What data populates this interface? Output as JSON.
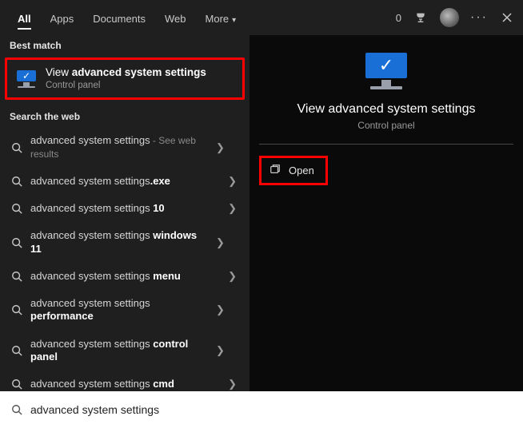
{
  "tabs": {
    "items": [
      "All",
      "Apps",
      "Documents",
      "Web",
      "More"
    ],
    "active_index": 0,
    "more_caret": "▾"
  },
  "header_right": {
    "points": "0",
    "trophy_icon": "trophy-icon",
    "avatar_icon": "avatar-icon",
    "more_label": "···",
    "close_label": "×"
  },
  "left": {
    "best_match_label": "Best match",
    "best_match": {
      "title_prefix": "View ",
      "title_bold": "advanced system settings",
      "subtitle": "Control panel",
      "icon": "monitor-check-icon"
    },
    "web_label": "Search the web",
    "web_items": [
      {
        "prefix": "advanced system settings",
        "bold": "",
        "suffix": " - See web results",
        "suffix_class": "sub",
        "multiline": true
      },
      {
        "prefix": "advanced system settings",
        "bold": ".exe",
        "suffix": ""
      },
      {
        "prefix": "advanced system settings ",
        "bold": "10",
        "suffix": ""
      },
      {
        "prefix": "advanced system settings ",
        "bold": "windows 11",
        "suffix": "",
        "multiline": true
      },
      {
        "prefix": "advanced system settings ",
        "bold": "menu",
        "suffix": ""
      },
      {
        "prefix": "advanced system settings ",
        "bold": "performance",
        "suffix": "",
        "multiline": true
      },
      {
        "prefix": "advanced system settings ",
        "bold": "control panel",
        "suffix": "",
        "multiline": true
      },
      {
        "prefix": "advanced system settings ",
        "bold": "cmd",
        "suffix": ""
      }
    ],
    "chevron": "❯"
  },
  "right": {
    "title": "View advanced system settings",
    "subtitle": "Control panel",
    "icon": "monitor-check-icon",
    "open_label": "Open",
    "open_icon": "open-external-icon"
  },
  "search": {
    "icon": "search-icon",
    "value": "advanced system settings"
  },
  "colors": {
    "highlight_border": "#ff0000",
    "accent_blue": "#1a6fd6",
    "bg_dark": "#1f1f1f",
    "bg_black": "#0a0a0a"
  }
}
